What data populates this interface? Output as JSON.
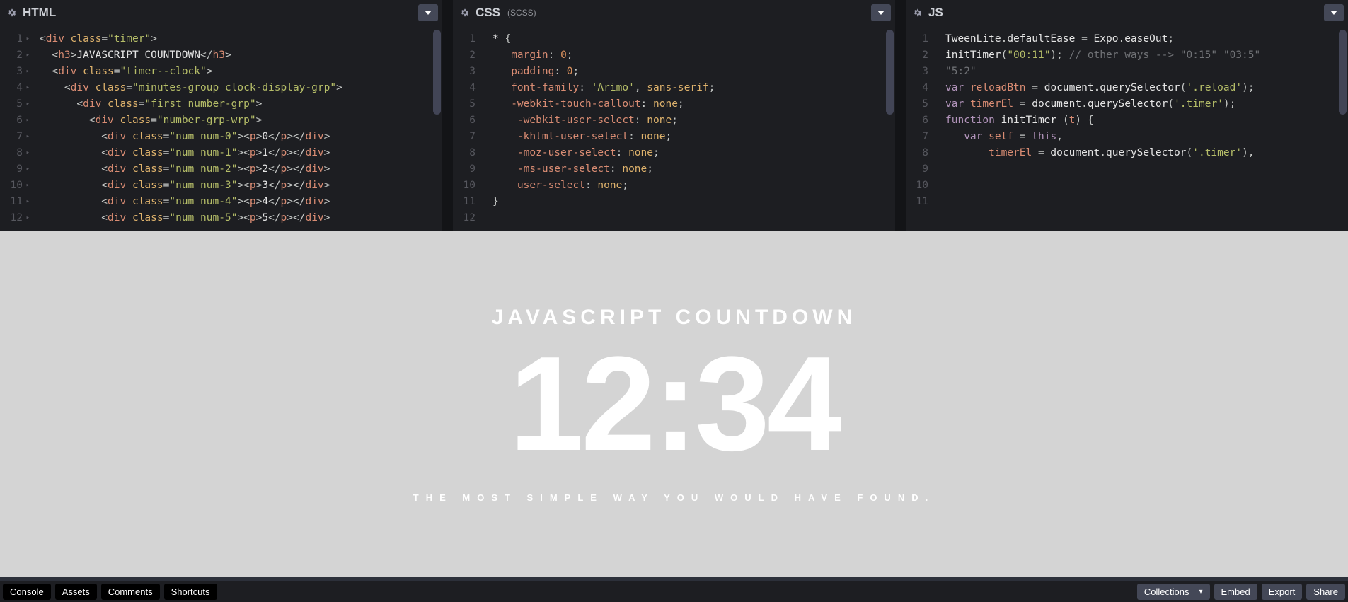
{
  "panes": {
    "html": {
      "title": "HTML",
      "subtitle": ""
    },
    "css": {
      "title": "CSS",
      "subtitle": "(SCSS)"
    },
    "js": {
      "title": "JS",
      "subtitle": ""
    }
  },
  "gutters": {
    "html": [
      "1",
      "2",
      "3",
      "4",
      "5",
      "6",
      "7",
      "8",
      "9",
      "10",
      "11",
      "12"
    ],
    "css": [
      "1",
      "2",
      "3",
      "4",
      "5",
      "6",
      "7",
      "8",
      "9",
      "10",
      "11",
      "12"
    ],
    "js": [
      "1",
      "2",
      "3",
      "",
      "4",
      "5",
      "6",
      "7",
      "8",
      "9",
      "10",
      "11"
    ]
  },
  "code": {
    "html": [
      [
        [
          "t-punc",
          "<"
        ],
        [
          "t-tag",
          "div"
        ],
        [
          "t-punc",
          " "
        ],
        [
          "t-attr",
          "class"
        ],
        [
          "t-punc",
          "="
        ],
        [
          "t-str",
          "\"timer\""
        ],
        [
          "t-punc",
          ">"
        ]
      ],
      [
        [
          "t-punc",
          "  <"
        ],
        [
          "t-tag",
          "h3"
        ],
        [
          "t-punc",
          ">"
        ],
        [
          "t-text",
          "JAVASCRIPT COUNTDOWN"
        ],
        [
          "t-punc",
          "</"
        ],
        [
          "t-tag",
          "h3"
        ],
        [
          "t-punc",
          ">"
        ]
      ],
      [
        [
          "t-punc",
          "  <"
        ],
        [
          "t-tag",
          "div"
        ],
        [
          "t-punc",
          " "
        ],
        [
          "t-attr",
          "class"
        ],
        [
          "t-punc",
          "="
        ],
        [
          "t-str",
          "\"timer--clock\""
        ],
        [
          "t-punc",
          ">"
        ]
      ],
      [
        [
          "t-punc",
          "    <"
        ],
        [
          "t-tag",
          "div"
        ],
        [
          "t-punc",
          " "
        ],
        [
          "t-attr",
          "class"
        ],
        [
          "t-punc",
          "="
        ],
        [
          "t-str",
          "\"minutes-group clock-display-grp\""
        ],
        [
          "t-punc",
          ">"
        ]
      ],
      [
        [
          "t-punc",
          "      <"
        ],
        [
          "t-tag",
          "div"
        ],
        [
          "t-punc",
          " "
        ],
        [
          "t-attr",
          "class"
        ],
        [
          "t-punc",
          "="
        ],
        [
          "t-str",
          "\"first number-grp\""
        ],
        [
          "t-punc",
          ">"
        ]
      ],
      [
        [
          "t-punc",
          "        <"
        ],
        [
          "t-tag",
          "div"
        ],
        [
          "t-punc",
          " "
        ],
        [
          "t-attr",
          "class"
        ],
        [
          "t-punc",
          "="
        ],
        [
          "t-str",
          "\"number-grp-wrp\""
        ],
        [
          "t-punc",
          ">"
        ]
      ],
      [
        [
          "t-punc",
          "          <"
        ],
        [
          "t-tag",
          "div"
        ],
        [
          "t-punc",
          " "
        ],
        [
          "t-attr",
          "class"
        ],
        [
          "t-punc",
          "="
        ],
        [
          "t-str",
          "\"num num-0\""
        ],
        [
          "t-punc",
          "><"
        ],
        [
          "t-tag",
          "p"
        ],
        [
          "t-punc",
          ">"
        ],
        [
          "t-text",
          "0"
        ],
        [
          "t-punc",
          "</"
        ],
        [
          "t-tag",
          "p"
        ],
        [
          "t-punc",
          "></"
        ],
        [
          "t-tag",
          "div"
        ],
        [
          "t-punc",
          ">"
        ]
      ],
      [
        [
          "t-punc",
          "          <"
        ],
        [
          "t-tag",
          "div"
        ],
        [
          "t-punc",
          " "
        ],
        [
          "t-attr",
          "class"
        ],
        [
          "t-punc",
          "="
        ],
        [
          "t-str",
          "\"num num-1\""
        ],
        [
          "t-punc",
          "><"
        ],
        [
          "t-tag",
          "p"
        ],
        [
          "t-punc",
          ">"
        ],
        [
          "t-text",
          "1"
        ],
        [
          "t-punc",
          "</"
        ],
        [
          "t-tag",
          "p"
        ],
        [
          "t-punc",
          "></"
        ],
        [
          "t-tag",
          "div"
        ],
        [
          "t-punc",
          ">"
        ]
      ],
      [
        [
          "t-punc",
          "          <"
        ],
        [
          "t-tag",
          "div"
        ],
        [
          "t-punc",
          " "
        ],
        [
          "t-attr",
          "class"
        ],
        [
          "t-punc",
          "="
        ],
        [
          "t-str",
          "\"num num-2\""
        ],
        [
          "t-punc",
          "><"
        ],
        [
          "t-tag",
          "p"
        ],
        [
          "t-punc",
          ">"
        ],
        [
          "t-text",
          "2"
        ],
        [
          "t-punc",
          "</"
        ],
        [
          "t-tag",
          "p"
        ],
        [
          "t-punc",
          "></"
        ],
        [
          "t-tag",
          "div"
        ],
        [
          "t-punc",
          ">"
        ]
      ],
      [
        [
          "t-punc",
          "          <"
        ],
        [
          "t-tag",
          "div"
        ],
        [
          "t-punc",
          " "
        ],
        [
          "t-attr",
          "class"
        ],
        [
          "t-punc",
          "="
        ],
        [
          "t-str",
          "\"num num-3\""
        ],
        [
          "t-punc",
          "><"
        ],
        [
          "t-tag",
          "p"
        ],
        [
          "t-punc",
          ">"
        ],
        [
          "t-text",
          "3"
        ],
        [
          "t-punc",
          "</"
        ],
        [
          "t-tag",
          "p"
        ],
        [
          "t-punc",
          "></"
        ],
        [
          "t-tag",
          "div"
        ],
        [
          "t-punc",
          ">"
        ]
      ],
      [
        [
          "t-punc",
          "          <"
        ],
        [
          "t-tag",
          "div"
        ],
        [
          "t-punc",
          " "
        ],
        [
          "t-attr",
          "class"
        ],
        [
          "t-punc",
          "="
        ],
        [
          "t-str",
          "\"num num-4\""
        ],
        [
          "t-punc",
          "><"
        ],
        [
          "t-tag",
          "p"
        ],
        [
          "t-punc",
          ">"
        ],
        [
          "t-text",
          "4"
        ],
        [
          "t-punc",
          "</"
        ],
        [
          "t-tag",
          "p"
        ],
        [
          "t-punc",
          "></"
        ],
        [
          "t-tag",
          "div"
        ],
        [
          "t-punc",
          ">"
        ]
      ],
      [
        [
          "t-punc",
          "          <"
        ],
        [
          "t-tag",
          "div"
        ],
        [
          "t-punc",
          " "
        ],
        [
          "t-attr",
          "class"
        ],
        [
          "t-punc",
          "="
        ],
        [
          "t-str",
          "\"num num-5\""
        ],
        [
          "t-punc",
          "><"
        ],
        [
          "t-tag",
          "p"
        ],
        [
          "t-punc",
          ">"
        ],
        [
          "t-text",
          "5"
        ],
        [
          "t-punc",
          "</"
        ],
        [
          "t-tag",
          "p"
        ],
        [
          "t-punc",
          "></"
        ],
        [
          "t-tag",
          "div"
        ],
        [
          "t-punc",
          ">"
        ]
      ]
    ],
    "css": [
      [
        [
          "t-sel",
          "* "
        ],
        [
          "t-punc",
          "{"
        ]
      ],
      [
        [
          "t-punc",
          "   "
        ],
        [
          "t-prop",
          "margin"
        ],
        [
          "t-punc",
          ": "
        ],
        [
          "t-num",
          "0"
        ],
        [
          "t-punc",
          ";"
        ]
      ],
      [
        [
          "t-punc",
          "   "
        ],
        [
          "t-prop",
          "padding"
        ],
        [
          "t-punc",
          ": "
        ],
        [
          "t-num",
          "0"
        ],
        [
          "t-punc",
          ";"
        ]
      ],
      [
        [
          "t-punc",
          "   "
        ],
        [
          "t-prop",
          "font-family"
        ],
        [
          "t-punc",
          ": "
        ],
        [
          "t-str",
          "'Arimo'"
        ],
        [
          "t-punc",
          ", "
        ],
        [
          "t-val",
          "sans-serif"
        ],
        [
          "t-punc",
          ";"
        ]
      ],
      [
        [
          "t-punc",
          "   "
        ],
        [
          "t-prop",
          "-webkit-touch-callout"
        ],
        [
          "t-punc",
          ": "
        ],
        [
          "t-val",
          "none"
        ],
        [
          "t-punc",
          ";"
        ]
      ],
      [
        [
          "t-punc",
          "    "
        ],
        [
          "t-prop",
          "-webkit-user-select"
        ],
        [
          "t-punc",
          ": "
        ],
        [
          "t-val",
          "none"
        ],
        [
          "t-punc",
          ";"
        ]
      ],
      [
        [
          "t-punc",
          "    "
        ],
        [
          "t-prop",
          "-khtml-user-select"
        ],
        [
          "t-punc",
          ": "
        ],
        [
          "t-val",
          "none"
        ],
        [
          "t-punc",
          ";"
        ]
      ],
      [
        [
          "t-punc",
          "    "
        ],
        [
          "t-prop",
          "-moz-user-select"
        ],
        [
          "t-punc",
          ": "
        ],
        [
          "t-val",
          "none"
        ],
        [
          "t-punc",
          ";"
        ]
      ],
      [
        [
          "t-punc",
          "    "
        ],
        [
          "t-prop",
          "-ms-user-select"
        ],
        [
          "t-punc",
          ": "
        ],
        [
          "t-val",
          "none"
        ],
        [
          "t-punc",
          ";"
        ]
      ],
      [
        [
          "t-punc",
          "    "
        ],
        [
          "t-prop",
          "user-select"
        ],
        [
          "t-punc",
          ": "
        ],
        [
          "t-val",
          "none"
        ],
        [
          "t-punc",
          ";"
        ]
      ],
      [
        [
          "t-punc",
          "}"
        ]
      ],
      [
        [
          "",
          ""
        ]
      ]
    ],
    "js": [
      [
        [
          "t-obj",
          "TweenLite"
        ],
        [
          "t-punc",
          "."
        ],
        [
          "t-obj",
          "defaultEase"
        ],
        [
          "t-punc",
          " = "
        ],
        [
          "t-obj",
          "Expo"
        ],
        [
          "t-punc",
          "."
        ],
        [
          "t-obj",
          "easeOut"
        ],
        [
          "t-punc",
          ";"
        ]
      ],
      [
        [
          "",
          ""
        ]
      ],
      [
        [
          "t-fn",
          "initTimer"
        ],
        [
          "t-punc",
          "("
        ],
        [
          "t-str",
          "\"00:11\""
        ],
        [
          "t-punc",
          "); "
        ],
        [
          "t-cmnt",
          "// other ways --> \"0:15\" \"03:5\""
        ]
      ],
      [
        [
          "t-cmnt",
          "\"5:2\""
        ]
      ],
      [
        [
          "",
          ""
        ]
      ],
      [
        [
          "t-kw",
          "var"
        ],
        [
          "t-punc",
          " "
        ],
        [
          "t-var",
          "reloadBtn"
        ],
        [
          "t-punc",
          " = "
        ],
        [
          "t-obj",
          "document"
        ],
        [
          "t-punc",
          "."
        ],
        [
          "t-fn",
          "querySelector"
        ],
        [
          "t-punc",
          "("
        ],
        [
          "t-str",
          "'.reload'"
        ],
        [
          "t-punc",
          ");"
        ]
      ],
      [
        [
          "t-kw",
          "var"
        ],
        [
          "t-punc",
          " "
        ],
        [
          "t-var",
          "timerEl"
        ],
        [
          "t-punc",
          " = "
        ],
        [
          "t-obj",
          "document"
        ],
        [
          "t-punc",
          "."
        ],
        [
          "t-fn",
          "querySelector"
        ],
        [
          "t-punc",
          "("
        ],
        [
          "t-str",
          "'.timer'"
        ],
        [
          "t-punc",
          ");"
        ]
      ],
      [
        [
          "",
          ""
        ]
      ],
      [
        [
          "t-kw",
          "function"
        ],
        [
          "t-punc",
          " "
        ],
        [
          "t-fn",
          "initTimer"
        ],
        [
          "t-punc",
          " ("
        ],
        [
          "t-var",
          "t"
        ],
        [
          "t-punc",
          ") {"
        ]
      ],
      [
        [
          "",
          ""
        ]
      ],
      [
        [
          "t-punc",
          "   "
        ],
        [
          "t-kw",
          "var"
        ],
        [
          "t-punc",
          " "
        ],
        [
          "t-var",
          "self"
        ],
        [
          "t-punc",
          " = "
        ],
        [
          "t-kw",
          "this"
        ],
        [
          "t-punc",
          ","
        ]
      ],
      [
        [
          "t-punc",
          "       "
        ],
        [
          "t-var",
          "timerEl"
        ],
        [
          "t-punc",
          " = "
        ],
        [
          "t-obj",
          "document"
        ],
        [
          "t-punc",
          "."
        ],
        [
          "t-fn",
          "querySelector"
        ],
        [
          "t-punc",
          "("
        ],
        [
          "t-str",
          "'.timer'"
        ],
        [
          "t-punc",
          "),"
        ]
      ]
    ]
  },
  "preview": {
    "title": "JAVASCRIPT COUNTDOWN",
    "clock": "12:34",
    "subtitle": "THE MOST SIMPLE WAY YOU WOULD HAVE FOUND."
  },
  "footer": {
    "left": [
      "Console",
      "Assets",
      "Comments",
      "Shortcuts"
    ],
    "right": [
      "Collections",
      "Embed",
      "Export",
      "Share"
    ]
  }
}
